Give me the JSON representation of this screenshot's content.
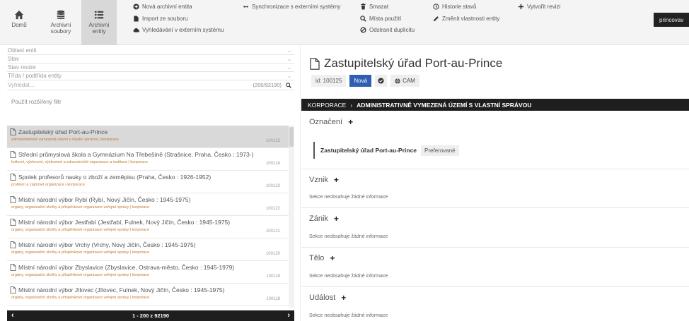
{
  "toolbar": {
    "nav": [
      {
        "label": "Domů",
        "icon": "home-icon"
      },
      {
        "label": "Archivní\nsoubory",
        "icon": "database-icon"
      },
      {
        "label": "Archivní\nentity",
        "icon": "list-icon"
      }
    ],
    "actions": {
      "new_entity": "Nová archivní entita",
      "import_file": "Import ze souboru",
      "search_external": "Vyhledávání v externím systému",
      "sync_external": "Synchronizace s externími systémy",
      "delete": "Smazat",
      "usage_places": "Místa použití",
      "remove_duplicity": "Odstranit duplicitu",
      "state_history": "Historie stavů",
      "change_properties": "Změnit vlastnosti entity",
      "create_revision": "Vytvořit revizi"
    },
    "user": "princovav"
  },
  "filters": {
    "entity_area": "Oblast entit",
    "state": "Stav",
    "revision_state": "Stav revize",
    "entity_class": "Třída / podtřída entity",
    "search_placeholder": "Vyhledat...",
    "result_count": "(200/92190)",
    "advanced_filter": "Použít rozšířený filtr"
  },
  "list": {
    "items": [
      {
        "title": "Zastupitelský úřad Port-au-Prince",
        "sub": "administrativně vymezená území s vlastní správou | korporace",
        "id": "100125",
        "selected": true
      },
      {
        "title": "Střední průmyslová škola a Gymnázium Na Třebešíně (Strašnice, Praha, Česko : 1973-)",
        "sub": "kulturní, výchovné, výzkumné a zdravotnické organizace a instituce | korporace",
        "id": "100124"
      },
      {
        "title": "Spolek profesorů nauky o zboží a zeměpisu (Praha, Česko : 1926-1952)",
        "sub": "profesní a zájmové organizace | korporace",
        "id": "100123"
      },
      {
        "title": "Místní národní výbor Rybí (Rybí, Nový Jičín, Česko : 1945-1975)",
        "sub": "orgány, organizační složky a příspěvkové organizace veřejné správy | korporace",
        "id": "100122"
      },
      {
        "title": "Místní národní výbor Jestřabí (Jestřabí, Fulnek, Nový Jičín, Česko : 1945-1975)",
        "sub": "orgány, organizační složky a příspěvkové organizace veřejné správy | korporace",
        "id": "100121"
      },
      {
        "title": "Místní národní výbor Vrchy (Vrchy, Nový Jičín, Česko : 1945-1975)",
        "sub": "orgány, organizační složky a příspěvkové organizace veřejné správy | korporace",
        "id": "100120"
      },
      {
        "title": "Místní národní výbor Zbyslavice (Zbyslavice, Ostrava-město, Česko : 1945-1979)",
        "sub": "orgány, organizační složky a příspěvkové organizace veřejné správy | korporace",
        "id": "100119"
      },
      {
        "title": "Místní národní výbor Jílovec (Jílovec, Fulnek, Nový Jičín, Česko : 1945-1975)",
        "sub": "orgány, organizační složky a příspěvkové organizace veřejné správy | korporace",
        "id": "100118"
      }
    ],
    "pager": "1 - 200 z 92190"
  },
  "detail": {
    "title": "Zastupitelský úřad Port-au-Prince",
    "id_label": "id: 100125",
    "state_badge": "Nová",
    "cam_label": "CAM",
    "breadcrumb_root": "KORPORACE",
    "breadcrumb_sep": "›",
    "breadcrumb_leaf": "ADMINISTRATIVNĚ VYMEZENÁ ÚZEMÍ S VLASTNÍ SPRÁVOU",
    "sections": {
      "naming": "Označení",
      "origin": "Vznik",
      "extinction": "Zánik",
      "body": "Tělo",
      "event": "Událost"
    },
    "naming_value": "Zastupitelský úřad Port-au-Prince",
    "preferred_label": "Preferované",
    "empty_text": "Sekce neobsahuje žádné informace"
  },
  "colors": {
    "accent": "#2f5fb3",
    "dark_bar": "#1e1e1e",
    "subtitle": "#c07a2c"
  }
}
